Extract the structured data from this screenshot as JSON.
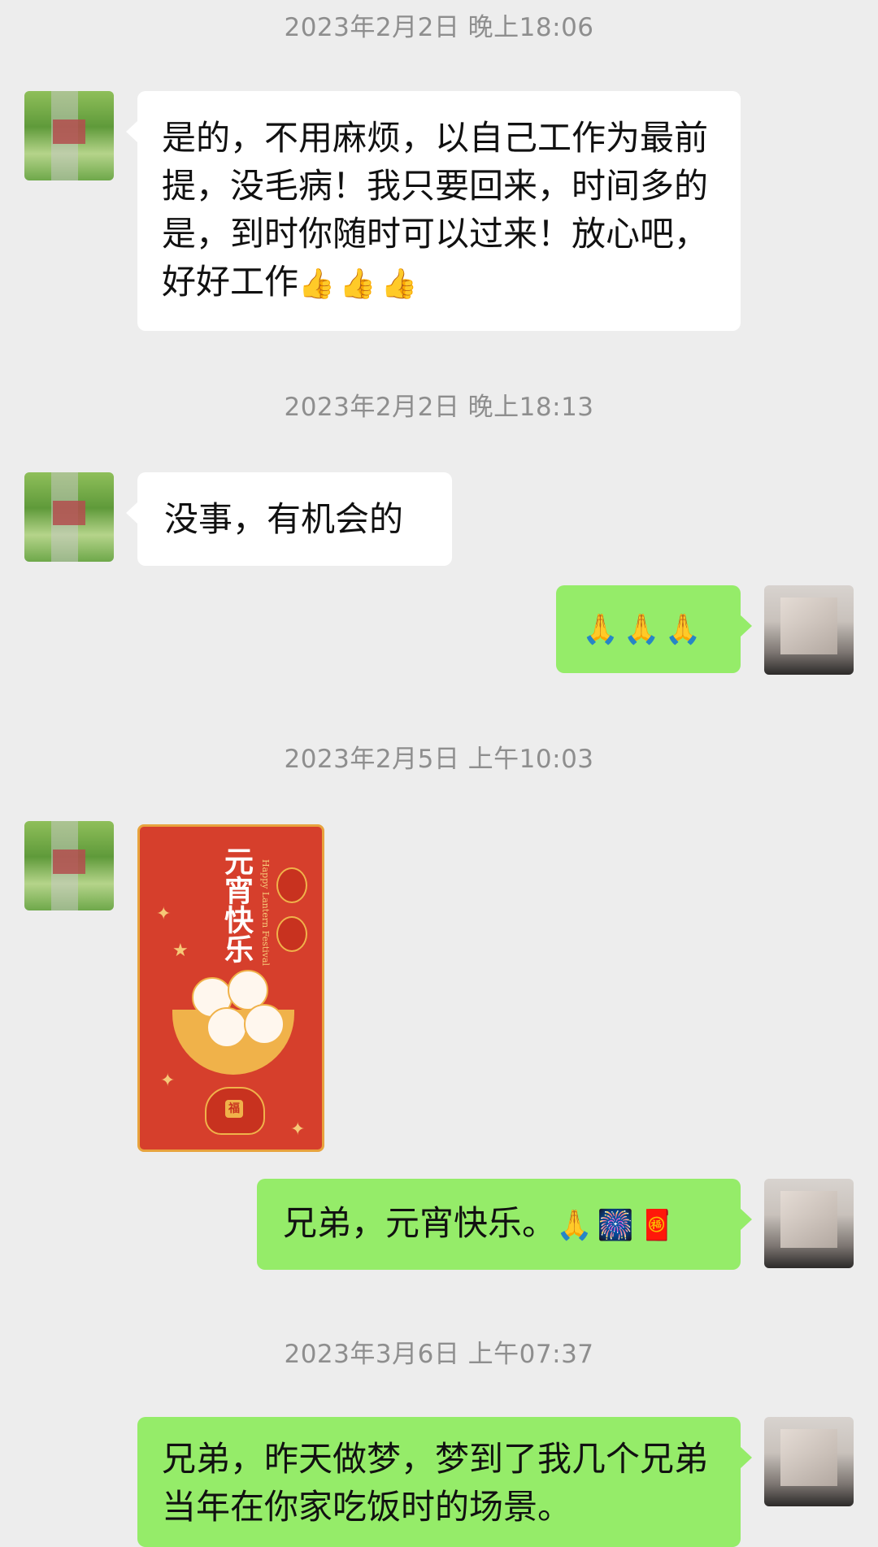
{
  "messages": {
    "ts1": "2023年2月2日 晚上18:06",
    "m1": "是的，不用麻烦，以自己工作为最前提，没毛病！我只要回来，时间多的是，到时你随时可以过来！放心吧，好好工作",
    "m1_emoji": "👍👍👍",
    "ts2": "2023年2月2日 晚上18:13",
    "m2": "没事，有机会的",
    "m3_emoji": "🙏🙏🙏",
    "ts3": "2023年2月5日 上午10:03",
    "sticker_title": "元宵快乐",
    "sticker_sub": "Happy Lantern Festival",
    "sticker_bag_char": "福",
    "m5": "兄弟，元宵快乐。",
    "m5_emoji": "🙏🎆🧧",
    "ts4": "2023年3月6日 上午07:37",
    "m6": "兄弟，昨天做梦，梦到了我几个兄弟当年在你家吃饭时的场景。"
  },
  "colors": {
    "background": "#ededed",
    "incoming_bubble": "#ffffff",
    "outgoing_bubble": "#95ec69",
    "timestamp_text": "#8e8e8e",
    "sticker_red": "#d63f2c"
  },
  "icons": {
    "friend_avatar": "friend-avatar-blurred",
    "self_avatar": "self-avatar-blurred"
  }
}
